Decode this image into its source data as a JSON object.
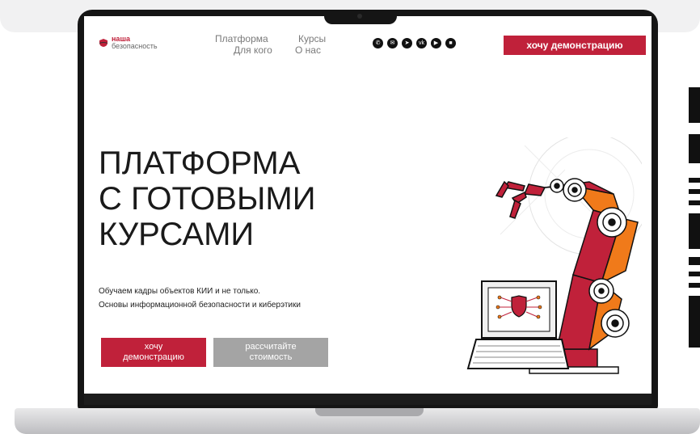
{
  "logo": {
    "line1": "наша",
    "line2": "безопасность"
  },
  "nav": {
    "items": [
      {
        "label": "Платформа"
      },
      {
        "label": "Курсы"
      },
      {
        "label": "Для кого"
      },
      {
        "label": "О нас"
      }
    ]
  },
  "socials": [
    {
      "icon": "phone-icon",
      "glyph": "✆"
    },
    {
      "icon": "mail-icon",
      "glyph": "✉"
    },
    {
      "icon": "telegram-icon",
      "glyph": "➤"
    },
    {
      "icon": "vk-icon",
      "glyph": "vk"
    },
    {
      "icon": "video-icon",
      "glyph": "▶"
    },
    {
      "icon": "media-icon",
      "glyph": "■"
    }
  ],
  "header": {
    "demo_button": "хочу демонстрацию"
  },
  "hero": {
    "title_lines": [
      "ПЛАТФОРМА",
      "С ГОТОВЫМИ",
      "КУРСАМИ"
    ],
    "subtitle_lines": [
      "Обучаем кадры объектов КИИ и не только.",
      "Основы информационной безопасности и киберэтики"
    ],
    "button_primary_lines": [
      "хочу",
      "демонстрацию"
    ],
    "button_secondary_lines": [
      "рассчитайте",
      "стоимость"
    ]
  },
  "colors": {
    "accent": "#c0213a",
    "secondary_button": "#a4a4a4",
    "robot_orange": "#f07a1a",
    "text_dark": "#1a1a1a"
  }
}
